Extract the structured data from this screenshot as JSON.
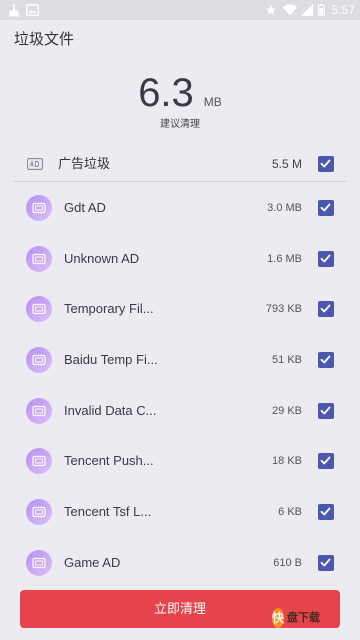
{
  "status_bar": {
    "time": "5:57",
    "left_icons": [
      "broom-icon",
      "image-icon"
    ],
    "right_icons": [
      "star-icon",
      "wifi-icon",
      "signal-icon",
      "battery-icon"
    ]
  },
  "header": {
    "title": "垃圾文件"
  },
  "summary": {
    "size_value": "6.3",
    "size_unit": "MB",
    "hint": "建议清理"
  },
  "category": {
    "icon": "ad-icon",
    "label": "广告垃圾",
    "size": "5.5 M",
    "checked": true
  },
  "items": [
    {
      "icon": "ad-card-icon",
      "name": "Gdt AD",
      "size": "3.0 MB",
      "checked": true
    },
    {
      "icon": "ad-card-icon",
      "name": "Unknown AD",
      "size": "1.6 MB",
      "checked": true
    },
    {
      "icon": "ad-card-icon",
      "name": "Temporary Fil...",
      "size": "793 KB",
      "checked": true
    },
    {
      "icon": "ad-card-icon",
      "name": "Baidu Temp Fi...",
      "size": "51 KB",
      "checked": true
    },
    {
      "icon": "ad-card-icon",
      "name": "Invalid Data C...",
      "size": "29 KB",
      "checked": true
    },
    {
      "icon": "ad-card-icon",
      "name": "Tencent Push...",
      "size": "18 KB",
      "checked": true
    },
    {
      "icon": "ad-card-icon",
      "name": "Tencent Tsf L...",
      "size": "6 KB",
      "checked": true
    },
    {
      "icon": "ad-card-icon",
      "name": "Game AD",
      "size": "610 B",
      "checked": true
    }
  ],
  "actions": {
    "clean_label": "立即清理"
  },
  "watermark": {
    "text": "快盘下载"
  },
  "colors": {
    "background": "#ebebf1",
    "accent": "#4a58b0",
    "button": "#e6434c",
    "icon_purple_start": "#b58ef0",
    "icon_purple_end": "#dcc2f7"
  }
}
